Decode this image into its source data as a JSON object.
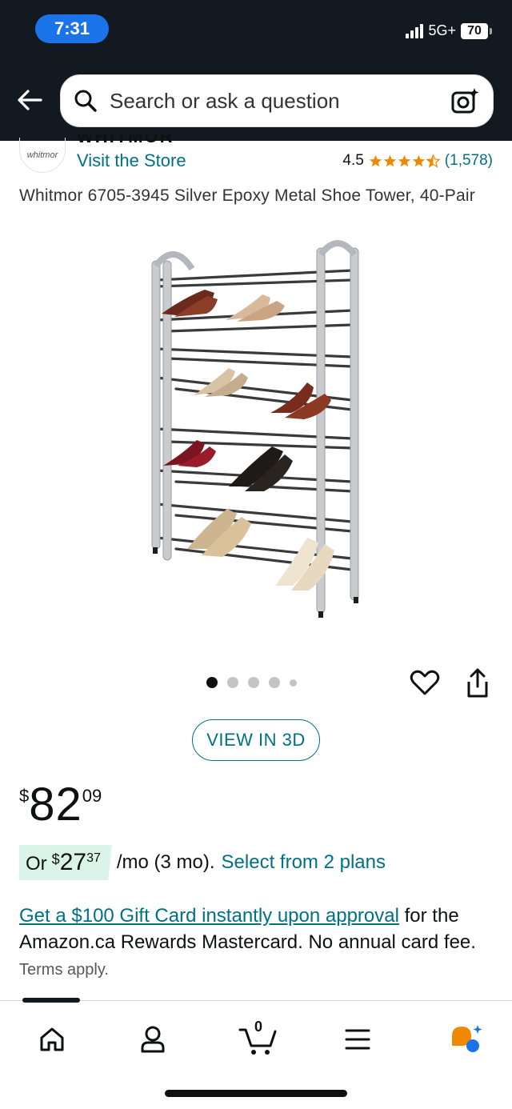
{
  "status_bar": {
    "time": "7:31",
    "network": "5G+",
    "battery": "70"
  },
  "search": {
    "placeholder": "Search or ask a question"
  },
  "brand": {
    "logo_text": "whitmor",
    "name_cut": "WHITMOR",
    "visit_store": "Visit the Store"
  },
  "rating": {
    "value": "4.5",
    "stars": 4.5,
    "count": "(1,578)"
  },
  "product": {
    "title": "Whitmor 6705-3945 Silver Epoxy Metal Shoe Tower, 40-Pair"
  },
  "carousel": {
    "total": 5,
    "active": 1
  },
  "view_3d": {
    "label": "VIEW IN 3D"
  },
  "price": {
    "currency": "$",
    "whole": "82",
    "fraction": "09"
  },
  "monthly": {
    "or": "Or",
    "currency": "$",
    "whole": "27",
    "fraction": "37",
    "per": "/mo (3 mo).",
    "plans_link": "Select from 2 plans"
  },
  "promo": {
    "link": "Get a $100 Gift Card instantly upon approval",
    "text": " for the Amazon.ca Rewards Mastercard. No annual card fee. ",
    "terms": "Terms apply."
  },
  "bottom_nav": {
    "cart_count": "0"
  },
  "colors": {
    "header": "#131921",
    "link": "#007185",
    "star": "#f08804",
    "deal_bg": "#dbf4ea"
  }
}
